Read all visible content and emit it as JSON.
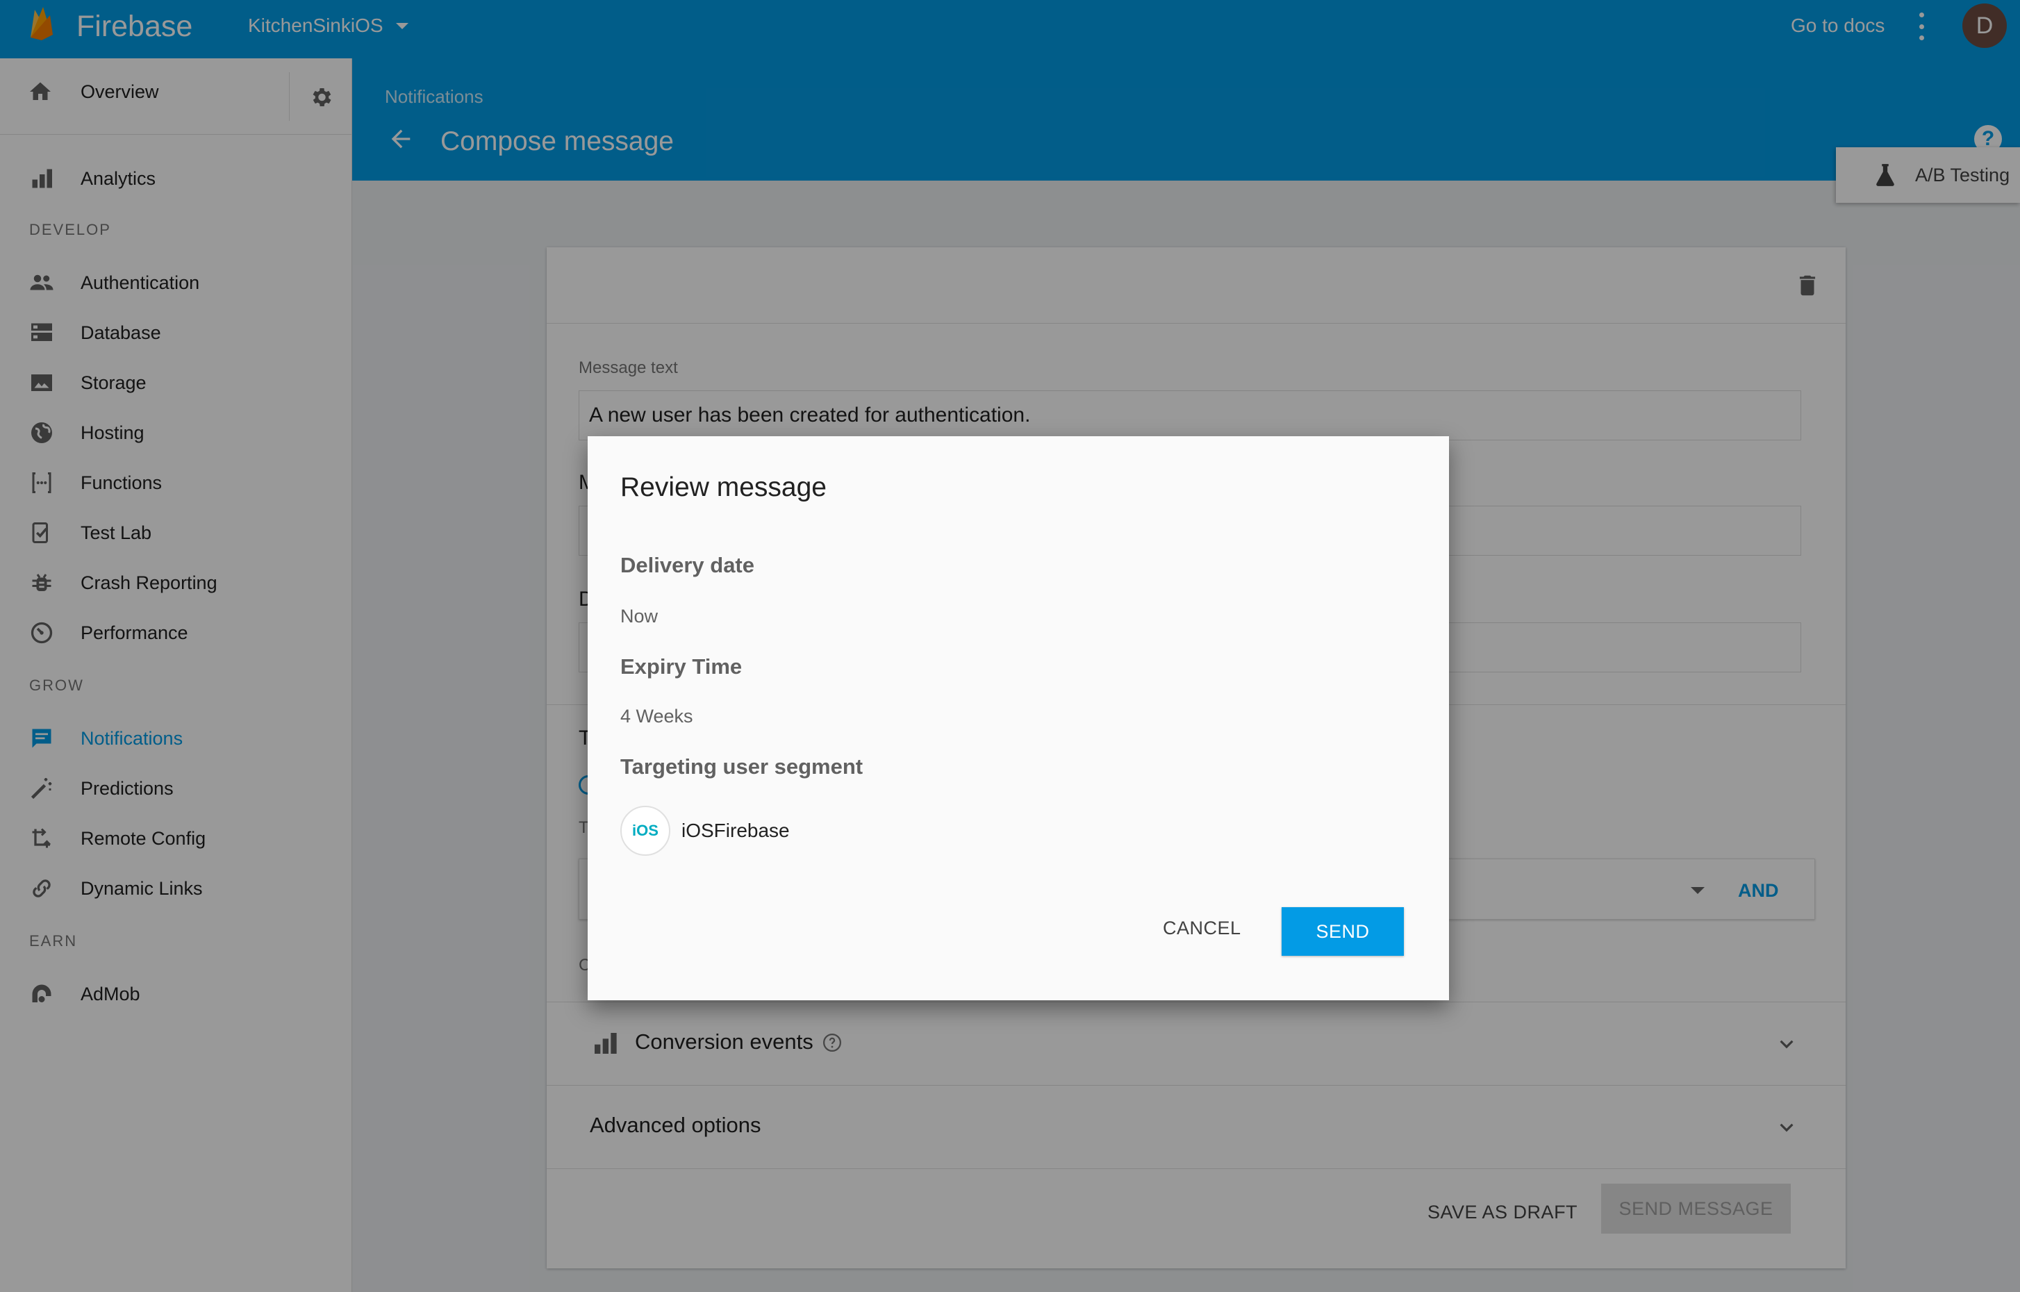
{
  "topbar": {
    "brand": "Firebase",
    "project": "KitchenSinkiOS",
    "docs_link": "Go to docs",
    "avatar_initial": "D"
  },
  "sidebar": {
    "overview": "Overview",
    "analytics": "Analytics",
    "sections": {
      "develop": "DEVELOP",
      "grow": "GROW",
      "earn": "EARN"
    },
    "develop_items": [
      {
        "label": "Authentication",
        "icon": "people-icon"
      },
      {
        "label": "Database",
        "icon": "database-icon"
      },
      {
        "label": "Storage",
        "icon": "image-icon"
      },
      {
        "label": "Hosting",
        "icon": "globe-icon"
      },
      {
        "label": "Functions",
        "icon": "functions-icon"
      },
      {
        "label": "Test Lab",
        "icon": "test-lab-icon"
      },
      {
        "label": "Crash Reporting",
        "icon": "bug-icon"
      },
      {
        "label": "Performance",
        "icon": "speedometer-icon"
      }
    ],
    "grow_items": [
      {
        "label": "Notifications",
        "icon": "message-icon",
        "active": true
      },
      {
        "label": "Predictions",
        "icon": "magic-wand-icon"
      },
      {
        "label": "Remote Config",
        "icon": "remote-config-icon"
      },
      {
        "label": "Dynamic Links",
        "icon": "link-icon"
      }
    ],
    "earn_items": [
      {
        "label": "AdMob",
        "icon": "admob-icon"
      }
    ]
  },
  "header": {
    "breadcrumb": "Notifications",
    "title": "Compose message",
    "ab_testing": "A/B Testing"
  },
  "card": {
    "message_label": "Message text",
    "message_value": "A new user has been created for authentication.",
    "stub_m": "M",
    "stub_d": "D",
    "stub_t": "T",
    "stub_t2": "T",
    "stub_c": "C",
    "and_label": "AND",
    "conversion_title": "Conversion events",
    "advanced_title": "Advanced options",
    "save_draft": "SAVE AS DRAFT",
    "send_message": "SEND MESSAGE"
  },
  "dialog": {
    "title": "Review message",
    "delivery_label": "Delivery date",
    "delivery_value": "Now",
    "expiry_label": "Expiry Time",
    "expiry_value": "4 Weeks",
    "segment_label": "Targeting user segment",
    "segment_badge": "iOS",
    "segment_name": "iOSFirebase",
    "cancel": "CANCEL",
    "send": "SEND"
  },
  "colors": {
    "brand_blue": "#039be5",
    "flame_orange": "#ffa000",
    "sidebar_active": "#039be5"
  }
}
